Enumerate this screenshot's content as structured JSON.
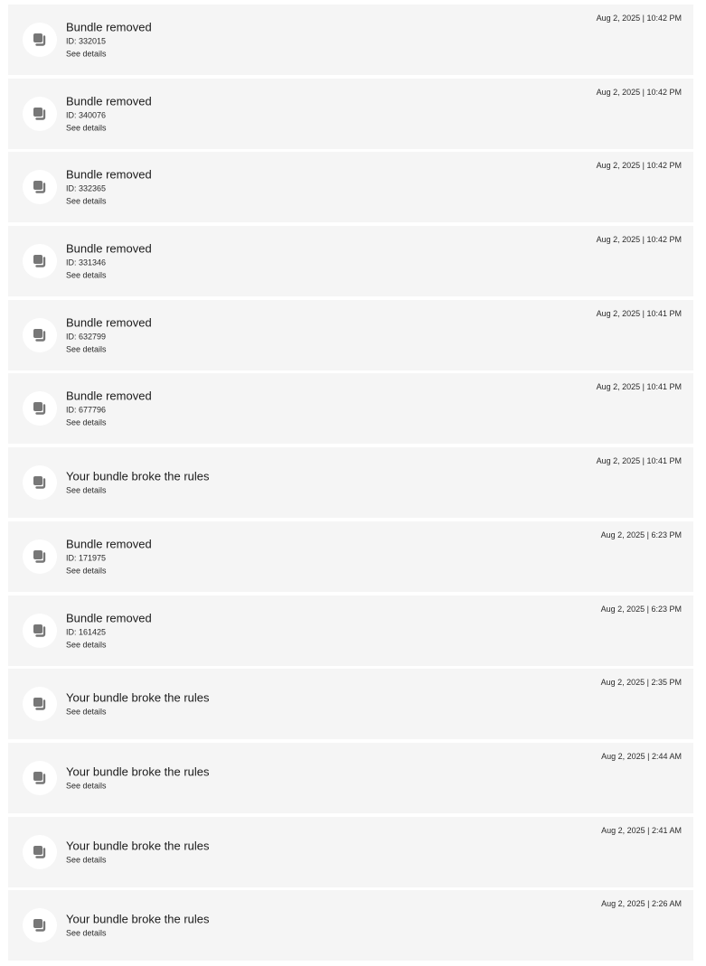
{
  "icons": {
    "notification_icon": "bundle-stack-icon",
    "icon_color": "#777777"
  },
  "notifications": [
    {
      "title": "Bundle removed",
      "id_text": "ID: 332015",
      "details": "See details",
      "timestamp": "Aug 2, 2025 | 10:42 PM"
    },
    {
      "title": "Bundle removed",
      "id_text": "ID: 340076",
      "details": "See details",
      "timestamp": "Aug 2, 2025 | 10:42 PM"
    },
    {
      "title": "Bundle removed",
      "id_text": "ID: 332365",
      "details": "See details",
      "timestamp": "Aug 2, 2025 | 10:42 PM"
    },
    {
      "title": "Bundle removed",
      "id_text": "ID: 331346",
      "details": "See details",
      "timestamp": "Aug 2, 2025 | 10:42 PM"
    },
    {
      "title": "Bundle removed",
      "id_text": "ID: 632799",
      "details": "See details",
      "timestamp": "Aug 2, 2025 | 10:41 PM"
    },
    {
      "title": "Bundle removed",
      "id_text": "ID: 677796",
      "details": "See details",
      "timestamp": "Aug 2, 2025 | 10:41 PM"
    },
    {
      "title": "Your bundle broke the rules",
      "details": "See details",
      "timestamp": "Aug 2, 2025 | 10:41 PM"
    },
    {
      "title": "Bundle removed",
      "id_text": "ID: 171975",
      "details": "See details",
      "timestamp": "Aug 2, 2025 | 6:23 PM"
    },
    {
      "title": "Bundle removed",
      "id_text": "ID: 161425",
      "details": "See details",
      "timestamp": "Aug 2, 2025 | 6:23 PM"
    },
    {
      "title": "Your bundle broke the rules",
      "details": "See details",
      "timestamp": "Aug 2, 2025 | 2:35 PM"
    },
    {
      "title": "Your bundle broke the rules",
      "details": "See details",
      "timestamp": "Aug 2, 2025 | 2:44 AM"
    },
    {
      "title": "Your bundle broke the rules",
      "details": "See details",
      "timestamp": "Aug 2, 2025 | 2:41 AM"
    },
    {
      "title": "Your bundle broke the rules",
      "details": "See details",
      "timestamp": "Aug 2, 2025 | 2:26 AM"
    }
  ]
}
